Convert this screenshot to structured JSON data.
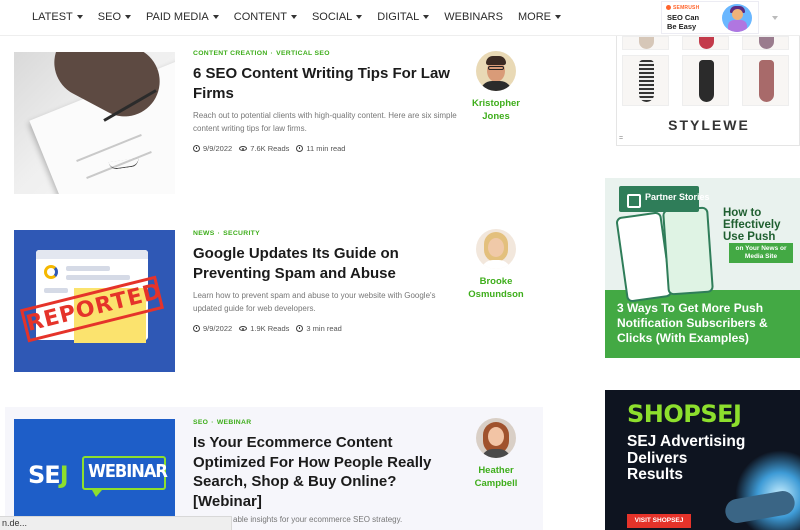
{
  "nav": {
    "items": [
      {
        "label": "LATEST",
        "dropdown": true
      },
      {
        "label": "SEO",
        "dropdown": true
      },
      {
        "label": "PAID MEDIA",
        "dropdown": true
      },
      {
        "label": "CONTENT",
        "dropdown": true
      },
      {
        "label": "SOCIAL",
        "dropdown": true
      },
      {
        "label": "DIGITAL",
        "dropdown": true
      },
      {
        "label": "WEBINARS",
        "dropdown": false
      },
      {
        "label": "MORE",
        "dropdown": true
      }
    ],
    "promo": {
      "logo": "SEMRUSH",
      "text": "SEO Can Be Easy"
    }
  },
  "articles": [
    {
      "categories": [
        "CONTENT CREATION",
        "VERTICAL SEO"
      ],
      "title": "6 SEO Content Writing Tips For Law Firms",
      "excerpt": "Reach out to potential clients with high-quality content. Here are six simple content writing tips for law firms.",
      "date": "9/9/2022",
      "reads": "7.6K Reads",
      "read_time": "11 min read",
      "author": "Kristopher Jones"
    },
    {
      "categories": [
        "NEWS",
        "SECURITY"
      ],
      "title": "Google Updates Its Guide on Preventing Spam and Abuse",
      "excerpt": "Learn how to prevent spam and abuse to your website with Google's updated guide for web developers.",
      "date": "9/9/2022",
      "reads": "1.9K Reads",
      "read_time": "3 min read",
      "author": "Brooke Osmundson",
      "image_text": "REPORTED"
    },
    {
      "categories": [
        "SEO",
        "WEBINAR"
      ],
      "title": "Is Your Ecommerce Content Optimized For How People Really Search, Shop & Buy Online? [Webinar]",
      "excerpt": "able insights for your ecommerce SEO strategy.",
      "author": "Heather Campbell",
      "image_text": {
        "sej": "SE",
        "j": "J",
        "word": "WEBINAR"
      }
    }
  ],
  "ads": {
    "stylewe": {
      "brand": "STYLEWE",
      "mark": "="
    },
    "push": {
      "label": "Partner Stories",
      "headline": "How to Effectively Use Push",
      "sub": "on Your News or Media Site",
      "text": "3 Ways To Get More Push Notification Subscribers & Clicks (With Examples)"
    },
    "shopsej": {
      "logo": "SHOPSEJ",
      "text": "SEJ Advertising Delivers Results",
      "button": "VISIT SHOPSEJ"
    }
  },
  "statusbar": {
    "text": "n.de..."
  },
  "colors": {
    "accent_green": "#3fae1c",
    "nav_text": "#2b2b2b",
    "title_text": "#1b1b1b"
  }
}
